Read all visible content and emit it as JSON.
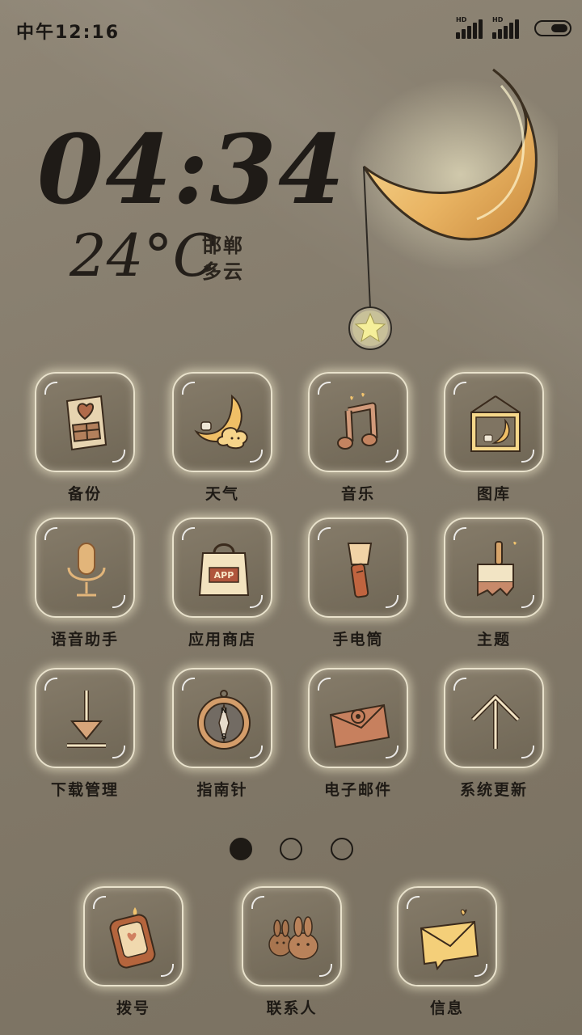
{
  "status_bar": {
    "time": "中午12:16",
    "signal_1_label": "HD",
    "signal_2_label": "HD"
  },
  "clock_widget": {
    "time": "04:34",
    "temperature": "24°C",
    "city": "邯郸",
    "condition": "多云"
  },
  "apps": [
    {
      "label": "备份",
      "icon": "backup-document-icon"
    },
    {
      "label": "天气",
      "icon": "moon-cloud-icon"
    },
    {
      "label": "音乐",
      "icon": "music-note-icon"
    },
    {
      "label": "图库",
      "icon": "picture-frame-icon"
    },
    {
      "label": "语音助手",
      "icon": "microphone-icon"
    },
    {
      "label": "应用商店",
      "icon": "shopping-bag-icon"
    },
    {
      "label": "手电筒",
      "icon": "flashlight-icon"
    },
    {
      "label": "主题",
      "icon": "paint-brush-icon"
    },
    {
      "label": "下载管理",
      "icon": "download-arrow-icon"
    },
    {
      "label": "指南针",
      "icon": "compass-icon"
    },
    {
      "label": "电子邮件",
      "icon": "email-envelope-icon"
    },
    {
      "label": "系统更新",
      "icon": "update-arrow-icon"
    }
  ],
  "store_icon_text": "APP",
  "compass_letters": {
    "north": "N",
    "south": "S"
  },
  "page_indicator": {
    "total": 3,
    "current": 1
  },
  "dock": [
    {
      "label": "拨号",
      "icon": "phone-icon"
    },
    {
      "label": "联系人",
      "icon": "bunnies-contacts-icon"
    },
    {
      "label": "信息",
      "icon": "message-envelope-icon"
    }
  ],
  "colors": {
    "background": "#857c6c",
    "tile": "#7a705f",
    "glow": "#fff8d7",
    "moon": "#f2c46e",
    "text": "#1e1a15"
  }
}
